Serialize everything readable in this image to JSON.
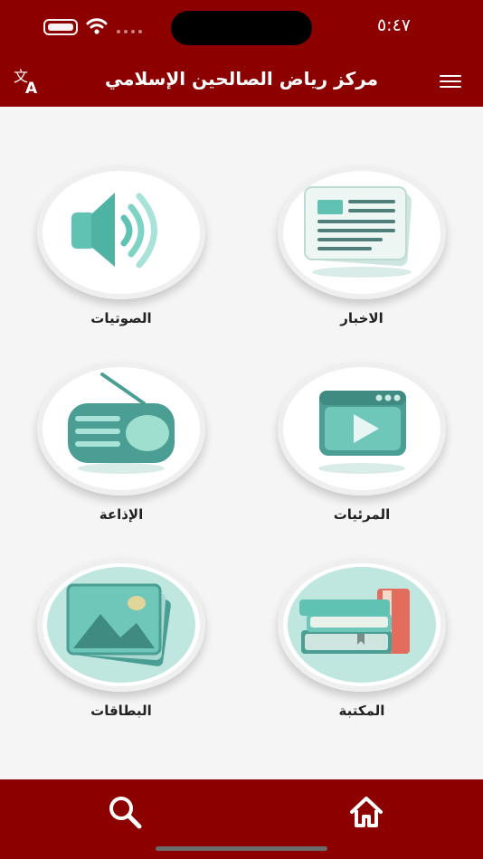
{
  "status_bar": {
    "time": "٥:٤٧"
  },
  "header": {
    "title": "مركز رياض الصالحين الإسلامي"
  },
  "tiles": [
    {
      "label": "الاخبار",
      "icon": "newspaper-icon"
    },
    {
      "label": "الصوتيات",
      "icon": "speaker-icon"
    },
    {
      "label": "المرئيات",
      "icon": "video-player-icon"
    },
    {
      "label": "الإذاعة",
      "icon": "radio-icon"
    },
    {
      "label": "المكتبة",
      "icon": "books-icon"
    },
    {
      "label": "البطاقات",
      "icon": "picture-cards-icon"
    }
  ],
  "bottom_nav": [
    {
      "icon": "search-icon"
    },
    {
      "icon": "home-icon"
    }
  ],
  "colors": {
    "brand": "#8c0000",
    "accent": "#5fc2b2",
    "background": "#f5f5f5"
  }
}
